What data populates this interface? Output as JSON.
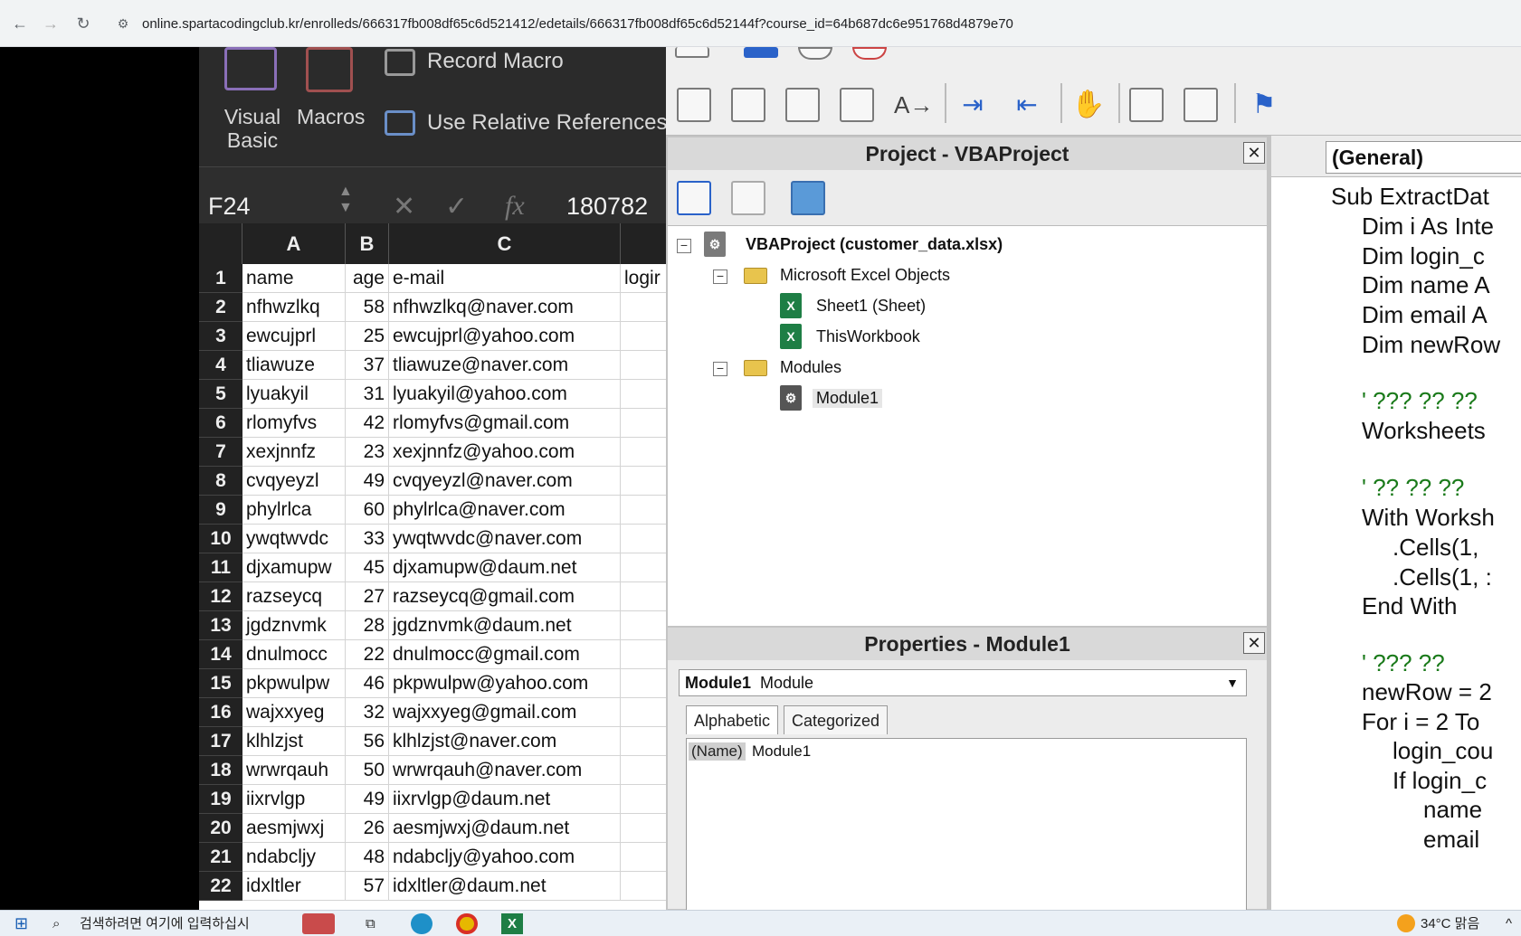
{
  "browser": {
    "url": "online.spartacodingclub.kr/enrolleds/666317fb008df65c6d521412/edetails/666317fb008df65c6d52144f?course_id=64b687dc6e951768d4879e70"
  },
  "excel": {
    "ribbon": {
      "visual_basic": "Visual Basic",
      "macros": "Macros",
      "record_macro": "Record Macro",
      "relative_refs": "Use Relative References"
    },
    "formula_bar": {
      "name_box": "F24",
      "fx": "fx",
      "value": "180782"
    },
    "columns": [
      "A",
      "B",
      "C"
    ],
    "rows": [
      {
        "n": "1",
        "a": "name",
        "b": "age",
        "c": "e-mail",
        "d": "logir"
      },
      {
        "n": "2",
        "a": "nfhwzlkq",
        "b": "58",
        "c": "nfhwzlkq@naver.com",
        "d": ""
      },
      {
        "n": "3",
        "a": "ewcujprl",
        "b": "25",
        "c": "ewcujprl@yahoo.com",
        "d": ""
      },
      {
        "n": "4",
        "a": "tliawuze",
        "b": "37",
        "c": "tliawuze@naver.com",
        "d": ""
      },
      {
        "n": "5",
        "a": "lyuakyil",
        "b": "31",
        "c": "lyuakyil@yahoo.com",
        "d": ""
      },
      {
        "n": "6",
        "a": "rlomyfvs",
        "b": "42",
        "c": "rlomyfvs@gmail.com",
        "d": ""
      },
      {
        "n": "7",
        "a": "xexjnnfz",
        "b": "23",
        "c": "xexjnnfz@yahoo.com",
        "d": ""
      },
      {
        "n": "8",
        "a": "cvqyeyzl",
        "b": "49",
        "c": "cvqyeyzl@naver.com",
        "d": ""
      },
      {
        "n": "9",
        "a": "phylrlca",
        "b": "60",
        "c": "phylrlca@naver.com",
        "d": ""
      },
      {
        "n": "10",
        "a": "ywqtwvdc",
        "b": "33",
        "c": "ywqtwvdc@naver.com",
        "d": ""
      },
      {
        "n": "11",
        "a": "djxamupw",
        "b": "45",
        "c": "djxamupw@daum.net",
        "d": ""
      },
      {
        "n": "12",
        "a": "razseycq",
        "b": "27",
        "c": "razseycq@gmail.com",
        "d": ""
      },
      {
        "n": "13",
        "a": "jgdznvmk",
        "b": "28",
        "c": "jgdznvmk@daum.net",
        "d": ""
      },
      {
        "n": "14",
        "a": "dnulmocc",
        "b": "22",
        "c": "dnulmocc@gmail.com",
        "d": ""
      },
      {
        "n": "15",
        "a": "pkpwulpw",
        "b": "46",
        "c": "pkpwulpw@yahoo.com",
        "d": ""
      },
      {
        "n": "16",
        "a": "wajxxyeg",
        "b": "32",
        "c": "wajxxyeg@gmail.com",
        "d": ""
      },
      {
        "n": "17",
        "a": "klhlzjst",
        "b": "56",
        "c": "klhlzjst@naver.com",
        "d": ""
      },
      {
        "n": "18",
        "a": "wrwrqauh",
        "b": "50",
        "c": "wrwrqauh@naver.com",
        "d": ""
      },
      {
        "n": "19",
        "a": "iixrvlgp",
        "b": "49",
        "c": "iixrvlgp@daum.net",
        "d": ""
      },
      {
        "n": "20",
        "a": "aesmjwxj",
        "b": "26",
        "c": "aesmjwxj@daum.net",
        "d": ""
      },
      {
        "n": "21",
        "a": "ndabcljy",
        "b": "48",
        "c": "ndabcljy@yahoo.com",
        "d": ""
      },
      {
        "n": "22",
        "a": "idxltler",
        "b": "57",
        "c": "idxltler@daum.net",
        "d": ""
      }
    ]
  },
  "vbe": {
    "project": {
      "title": "Project - VBAProject",
      "root": "VBAProject (customer_data.xlsx)",
      "excel_objects": "Microsoft Excel Objects",
      "sheet1": "Sheet1 (Sheet)",
      "workbook": "ThisWorkbook",
      "modules": "Modules",
      "module1": "Module1"
    },
    "properties": {
      "title": "Properties - Module1",
      "object_name": "Module1",
      "object_type": "Module",
      "tab_alpha": "Alphabetic",
      "tab_cat": "Categorized",
      "prop_name": "(Name)",
      "prop_value": "Module1"
    },
    "code": {
      "combo": "(General)",
      "lines": [
        "Sub ExtractDat",
        "Dim i As Inte",
        "Dim login_c",
        "Dim name A",
        "Dim email A",
        "Dim newRow",
        "' ??? ?? ??",
        "Worksheets",
        "' ?? ?? ??",
        "With Worksh",
        ".Cells(1,",
        ".Cells(1, :",
        "End With",
        "' ??? ??",
        "newRow = 2",
        "For i = 2 To",
        "login_cou",
        "If login_c",
        "name",
        "email"
      ]
    }
  },
  "taskbar": {
    "search_placeholder": "검색하려면 여기에 입력하십시",
    "weather": "34°C 맑음"
  }
}
